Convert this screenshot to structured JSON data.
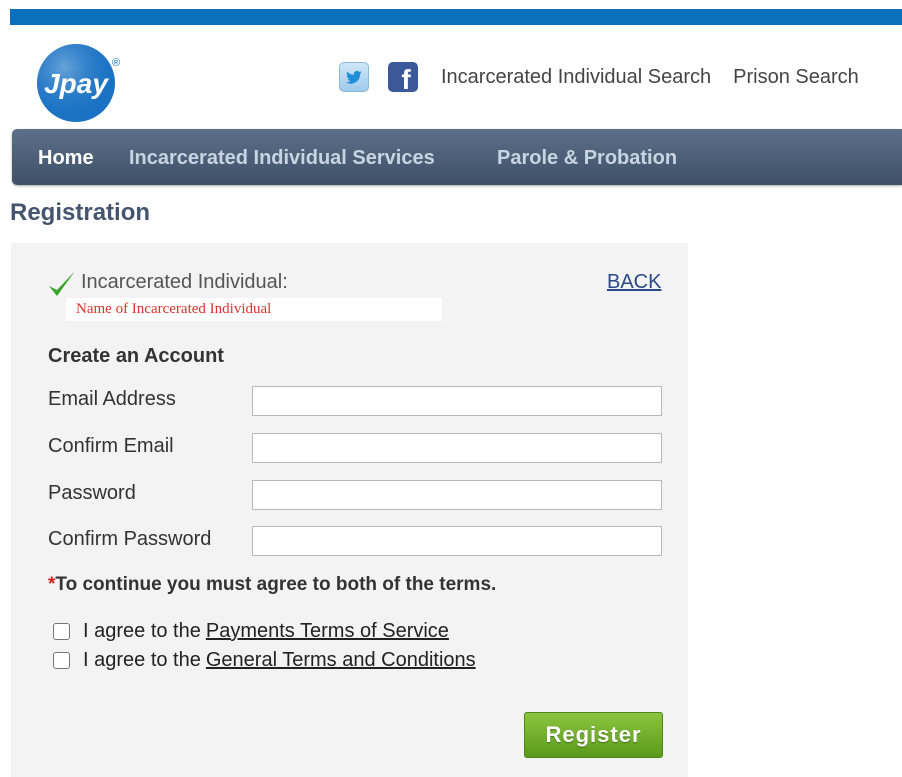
{
  "brand": {
    "logo_text": "Jpay",
    "logo_mark": "®",
    "logo_color": "#1a72c4"
  },
  "header": {
    "social": [
      {
        "name": "twitter-icon"
      },
      {
        "name": "facebook-icon",
        "glyph": "f"
      }
    ],
    "links": [
      "Incarcerated Individual Search",
      "Prison Search"
    ]
  },
  "nav": {
    "items": [
      "Home",
      "Incarcerated Individual Services",
      "Parole & Probation"
    ],
    "active": "Home"
  },
  "page": {
    "title": "Registration"
  },
  "inmate": {
    "label": "Incarcerated Individual:",
    "name_placeholder": "Name of Incarcerated Individual",
    "back_label": "BACK"
  },
  "account": {
    "title": "Create an Account",
    "fields": [
      {
        "label": "Email Address",
        "value": ""
      },
      {
        "label": "Confirm Email",
        "value": ""
      },
      {
        "label": "Password",
        "value": ""
      },
      {
        "label": "Confirm Password",
        "value": ""
      }
    ]
  },
  "terms": {
    "required_mark": "*",
    "note": "To continue you must agree to both of the terms.",
    "items": [
      {
        "prefix": "I agree to the",
        "link": "Payments Terms of Service",
        "checked": false
      },
      {
        "prefix": "I agree to the",
        "link": "General Terms and Conditions",
        "checked": false
      }
    ]
  },
  "actions": {
    "register_label": "Register"
  },
  "colors": {
    "topbar": "#0a6fbd",
    "nav": "#4b5d77",
    "title": "#44566f",
    "panel": "#f3f3f3",
    "accent_green": "#6fae2a",
    "required": "#d21f1f"
  }
}
